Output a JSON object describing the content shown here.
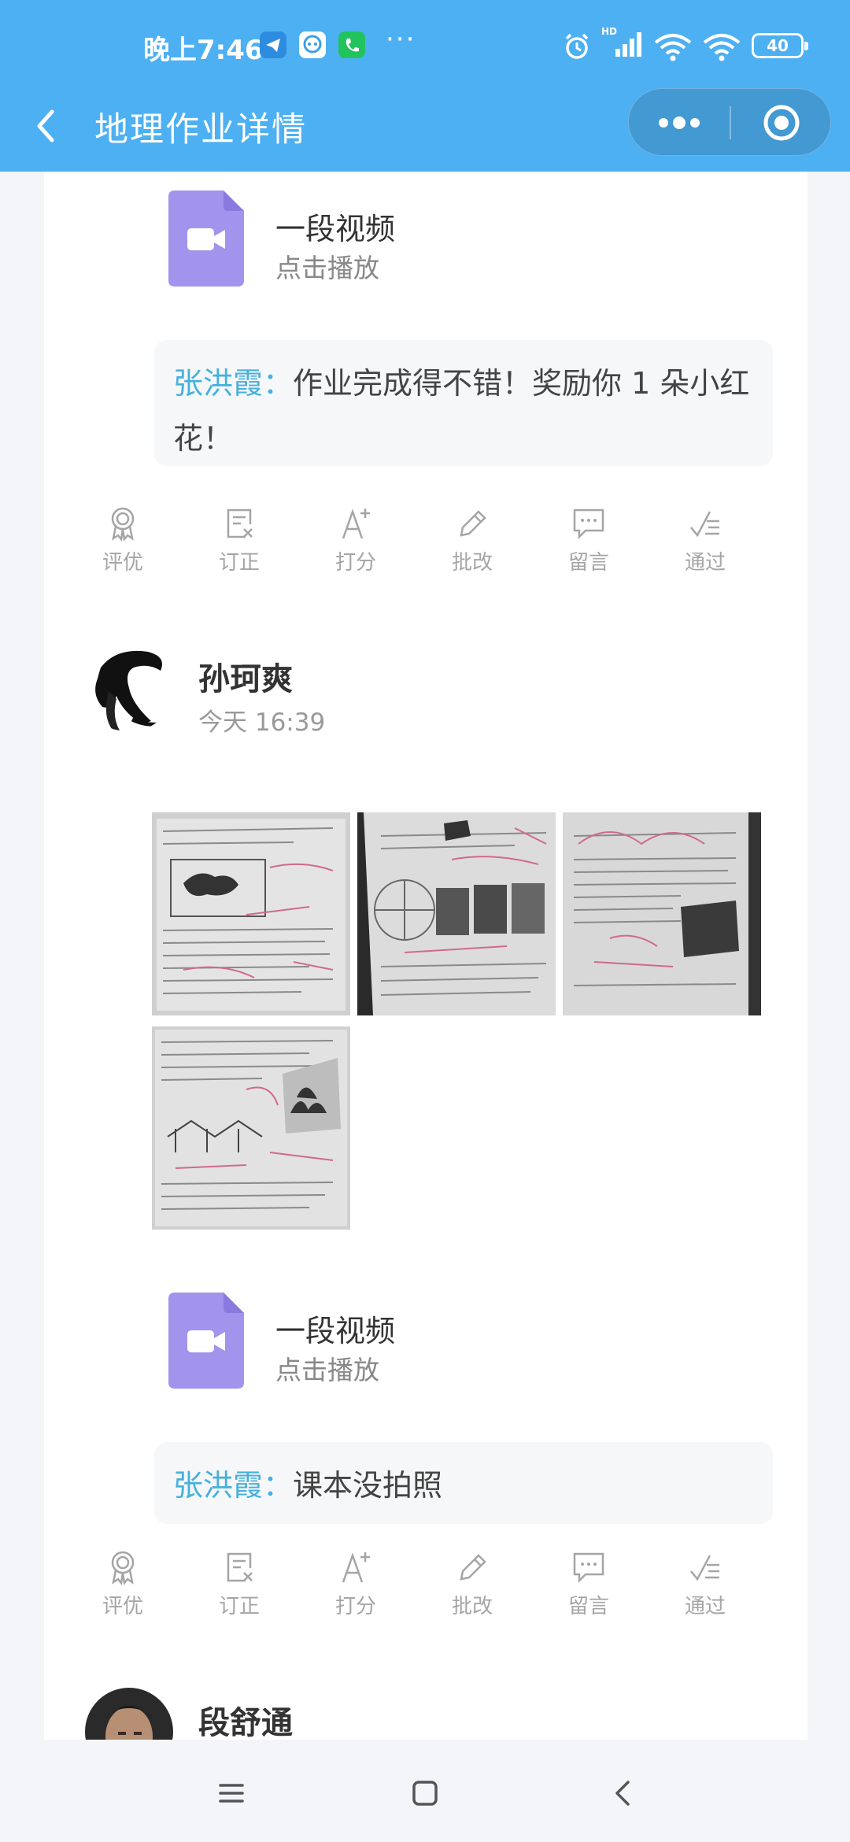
{
  "status_bar": {
    "time": "晚上7:46",
    "more": "···",
    "battery": "40",
    "signal_badge": "HD"
  },
  "header": {
    "title": "地理作业详情"
  },
  "videos": [
    {
      "title": "一段视频",
      "subtitle": "点击播放"
    },
    {
      "title": "一段视频",
      "subtitle": "点击播放"
    }
  ],
  "comments": [
    {
      "author": "张洪霞：",
      "text": "作业完成得不错！奖励你 1 朵小红花！"
    },
    {
      "author": "张洪霞：",
      "text": "课本没拍照"
    }
  ],
  "actions": [
    "评优",
    "订正",
    "打分",
    "批改",
    "留言",
    "通过"
  ],
  "students": [
    {
      "name": "孙珂爽",
      "time": "今天 16:39"
    },
    {
      "name": "段舒通"
    }
  ],
  "colors": {
    "header_bg": "#4db0f2",
    "comment_author": "#46b0dc",
    "video_icon": "#a294ec",
    "action_gray": "#a5a5a5"
  },
  "icons": {
    "actions": [
      "award-icon",
      "correct-icon",
      "score-icon",
      "edit-pencil-icon",
      "message-icon",
      "approve-icon"
    ],
    "nav": [
      "back-icon",
      "more-icon",
      "close-target-icon"
    ],
    "system_nav": [
      "menu-icon",
      "home-icon",
      "back-icon"
    ]
  }
}
